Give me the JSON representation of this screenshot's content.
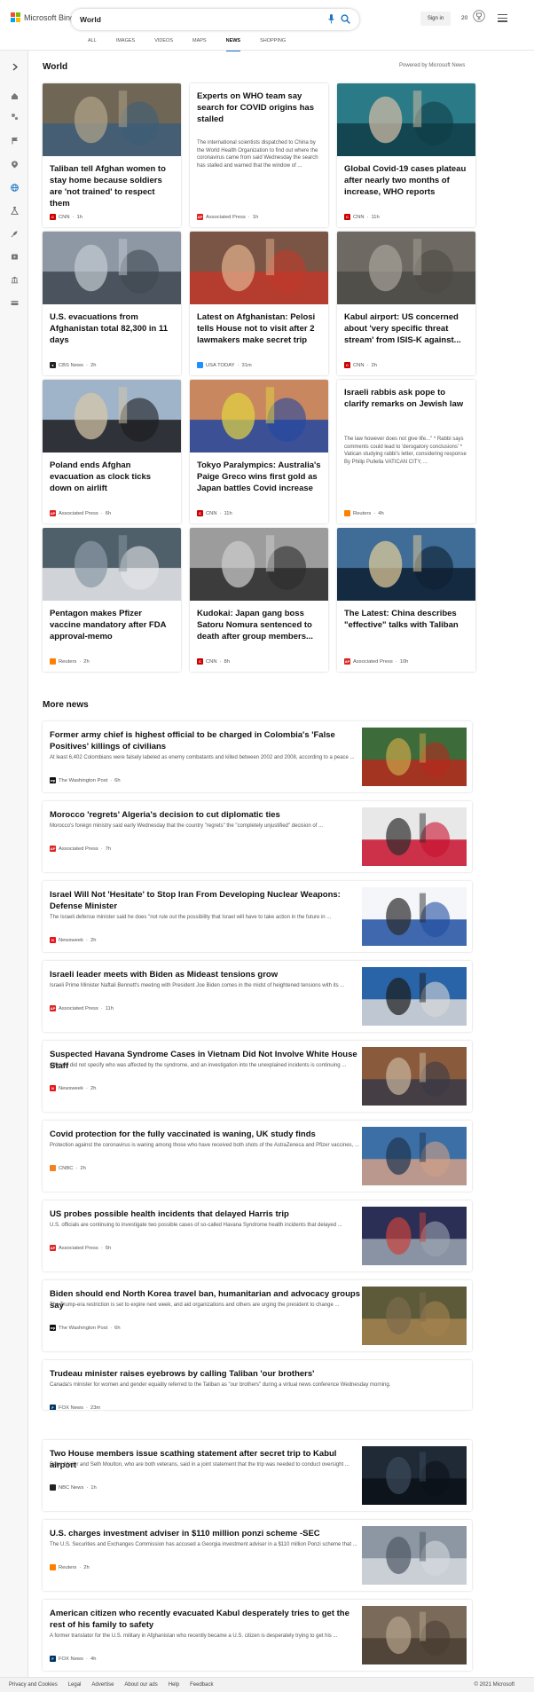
{
  "brand": {
    "name": "Microsoft Bing",
    "colors": [
      "#f25022",
      "#7fba00",
      "#00a4ef",
      "#ffb900"
    ]
  },
  "search": {
    "query": "World",
    "placeholder": ""
  },
  "header": {
    "signin_label": "Sign in",
    "rewards_count": "20"
  },
  "tabs": [
    {
      "label": "ALL",
      "active": false
    },
    {
      "label": "IMAGES",
      "active": false
    },
    {
      "label": "VIDEOS",
      "active": false
    },
    {
      "label": "MAPS",
      "active": false
    },
    {
      "label": "NEWS",
      "active": true
    },
    {
      "label": "SHOPPING",
      "active": false
    }
  ],
  "sidebar": {
    "icons": [
      "chevron-right-icon",
      "home-icon",
      "sports-icon",
      "flag-icon",
      "location-pin-icon",
      "globe-icon",
      "science-icon",
      "rocket-icon",
      "entertainment-icon",
      "bank-icon",
      "money-icon"
    ]
  },
  "world": {
    "title": "World",
    "powered_by": "Powered by Microsoft News",
    "cards": [
      {
        "title": "Taliban tell Afghan women to stay home because soldiers are 'not trained' to respect them",
        "source": "CNN",
        "time": "1h",
        "logo_color": "#cc0000",
        "has_image": true,
        "img": [
          "#6f6656",
          "#3e5d78",
          "#b3a58a"
        ]
      },
      {
        "title": "Experts on WHO team say search for COVID origins has stalled",
        "snippet": "The international scientists dispatched to China by the World Health Organization to find out where the coronavirus came from said Wednesday the search has stalled and warned that the window of ...",
        "source": "Associated Press",
        "time": "1h",
        "logo_color": "#d22",
        "has_image": false
      },
      {
        "title": "Global Covid-19 cases plateau after nearly two months of increase, WHO reports",
        "source": "CNN",
        "time": "11h",
        "logo_color": "#cc0000",
        "has_image": true,
        "img": [
          "#2a7b87",
          "#0f3d47",
          "#d9c1a8"
        ]
      },
      {
        "title": "U.S. evacuations from Afghanistan total 82,300 in 11 days",
        "source": "CBS News",
        "time": "2h",
        "logo_color": "#222222",
        "has_image": true,
        "img": [
          "#8d98a4",
          "#3f4852",
          "#c3cad2"
        ]
      },
      {
        "title": "Latest on Afghanistan: Pelosi tells House not to visit after 2 lawmakers make secret trip",
        "source": "USA TODAY",
        "time": "31m",
        "logo_color": "#1e90ff",
        "has_image": true,
        "img": [
          "#7a5545",
          "#c0392b",
          "#e3b28e"
        ]
      },
      {
        "title": "Kabul airport: US concerned about 'very specific threat stream' from ISIS-K against...",
        "source": "CNN",
        "time": "2h",
        "logo_color": "#cc0000",
        "has_image": true,
        "img": [
          "#6e6a63",
          "#4c4a45",
          "#a7a39a"
        ]
      },
      {
        "title": "Poland ends Afghan evacuation as clock ticks down on airlift",
        "source": "Associated Press",
        "time": "6h",
        "logo_color": "#d22",
        "has_image": true,
        "img": [
          "#9fb4c8",
          "#1b1b1e",
          "#d8c8a8"
        ]
      },
      {
        "title": "Tokyo Paralympics: Australia's Paige Greco wins first gold as Japan battles Covid increase",
        "source": "CNN",
        "time": "11h",
        "logo_color": "#cc0000",
        "has_image": true,
        "img": [
          "#c8875f",
          "#2347a0",
          "#e1d640"
        ]
      },
      {
        "title": "Israeli rabbis ask pope to clarify remarks on Jewish law",
        "snippet": "The law however does not give life...\" * Rabbi says comments could lead to 'derogatory conclusions' * Vatican studying rabbi's letter, considering response By Philip Pullella VATICAN CITY, ...",
        "source": "Reuters",
        "time": "4h",
        "logo_color": "#ff8000",
        "has_image": false
      },
      {
        "title": "Pentagon makes Pfizer vaccine mandatory after FDA approval-memo",
        "source": "Reuters",
        "time": "2h",
        "logo_color": "#ff8000",
        "has_image": true,
        "img": [
          "#50606b",
          "#e6e8ea",
          "#8a9aa5"
        ]
      },
      {
        "title": "Kudokai: Japan gang boss Satoru Nomura sentenced to death after group members...",
        "source": "CNN",
        "time": "8h",
        "logo_color": "#cc0000",
        "has_image": true,
        "img": [
          "#9c9c9c",
          "#2b2b2b",
          "#cfcfcf"
        ]
      },
      {
        "title": "The Latest: China describes \"effective\" talks with Taliban",
        "source": "Associated Press",
        "time": "10h",
        "logo_color": "#d22",
        "has_image": true,
        "img": [
          "#3f6d97",
          "#0d1f31",
          "#e7d09a"
        ]
      }
    ]
  },
  "more_news": {
    "title": "More news",
    "items": [
      {
        "title": "Former army chief is highest official to be charged in Colombia's 'False Positives' killings of civilians",
        "snippet": "At least 6,402 Colombians were falsely labeled as enemy combatants and killed between 2002 and 2008, according to a peace ...",
        "source": "The Washington Post",
        "time": "6h",
        "logo_color": "#111111",
        "img": [
          "#3d6b3a",
          "#b52a1e",
          "#c9a64a"
        ]
      },
      {
        "title": "Morocco 'regrets' Algeria's decision to cut diplomatic ties",
        "snippet": "Morocco's foreign ministry said early Wednesday that the country \"regrets\" the \"completely unjustified\" decision of ...",
        "source": "Associated Press",
        "time": "7h",
        "logo_color": "#d22",
        "img": [
          "#e8e8e8",
          "#c8102e",
          "#2e2e2e"
        ]
      },
      {
        "title": "Israel Will Not 'Hesitate' to Stop Iran From Developing Nuclear Weapons: Defense Minister",
        "snippet": "The Israeli defense minister said he does \"not rule out the possibility that Israel will have to take action in the future in ...",
        "source": "Newsweek",
        "time": "2h",
        "logo_color": "#e5161b",
        "img": [
          "#f4f6fa",
          "#1f4fa0",
          "#2b2b2b"
        ]
      },
      {
        "title": "Israeli leader meets with Biden as Mideast tensions grow",
        "snippet": "Israeli Prime Minister Naftali Bennett's meeting with President Joe Biden comes in the midst of heightened tensions with its ...",
        "source": "Associated Press",
        "time": "11h",
        "logo_color": "#d22",
        "img": [
          "#2a64a8",
          "#d9d9d9",
          "#1b1b1b"
        ]
      },
      {
        "title": "Suspected Havana Syndrome Cases in Vietnam Did Not Involve White House Staff",
        "snippet": "Officials did not specify who was affected by the syndrome, and an investigation into the unexplained incidents is continuing ...",
        "source": "Newsweek",
        "time": "2h",
        "logo_color": "#e5161b",
        "img": [
          "#8a5a3c",
          "#3a3a46",
          "#c9b79e"
        ]
      },
      {
        "title": "Covid protection for the fully vaccinated is waning, UK study finds",
        "snippet": "Protection against the coronavirus is waning among those who have received both shots of the AstraZeneca and Pfizer vaccines, ...",
        "source": "CNBC",
        "time": "2h",
        "logo_color": "#f58220",
        "img": [
          "#3c6fa6",
          "#d0a088",
          "#1e3550"
        ]
      },
      {
        "title": "US probes possible health incidents that delayed Harris trip",
        "snippet": "U.S. officials are continuing to investigate two possible cases of so-called Havana Syndrome health incidents that delayed ...",
        "source": "Associated Press",
        "time": "5h",
        "logo_color": "#d22",
        "img": [
          "#2b2f55",
          "#9aa4b1",
          "#c7433c"
        ]
      },
      {
        "title": "Biden should end North Korea travel ban, humanitarian and advocacy groups say",
        "snippet": "The Trump-era restriction is set to expire next week, and aid organizations and others are urging the president to change ...",
        "source": "The Washington Post",
        "time": "6h",
        "logo_color": "#111111",
        "img": [
          "#5d5a3a",
          "#a3834f",
          "#7e6b4c"
        ]
      },
      {
        "title": "Trudeau minister raises eyebrows by calling Taliban 'our brothers'",
        "snippet": "Canada's minister for women and gender equality referred to the Taliban as \"our brothers\" during a virtual news conference Wednesday morning.",
        "source": "FOX News",
        "time": "23m",
        "logo_color": "#003366",
        "img": []
      },
      {
        "title": "Two House members issue scathing statement after secret trip to Kabul airport",
        "snippet": "Peter Meijer and Seth Moulton, who are both veterans, said in a joint statement that the trip was needed to conduct oversight ...",
        "source": "NBC News",
        "time": "1h",
        "logo_color": "#222222",
        "img": [
          "#1f2a36",
          "#0c1117",
          "#3c4a5a"
        ]
      },
      {
        "title": "U.S. charges investment adviser in $110 million ponzi scheme -SEC",
        "snippet": "The U.S. Securities and Exchanges Commission has accused a Georgia investment adviser in a $110 million Ponzi scheme that ...",
        "source": "Reuters",
        "time": "2h",
        "logo_color": "#ff8000",
        "img": [
          "#8c97a3",
          "#d3d8de",
          "#4f5964"
        ]
      },
      {
        "title": "American citizen who recently evacuated Kabul desperately tries to get the rest of his family to safety",
        "snippet": "A former translator for the U.S. military in Afghanistan who recently became a U.S. citizen is desperately trying to get his ...",
        "source": "FOX News",
        "time": "4h",
        "logo_color": "#003366",
        "img": [
          "#7a6a5a",
          "#4a3d33",
          "#b7a58d"
        ]
      }
    ]
  },
  "footer": {
    "links": [
      "Privacy and Cookies",
      "Legal",
      "Advertise",
      "About our ads",
      "Help",
      "Feedback"
    ],
    "copyright": "© 2021 Microsoft"
  }
}
